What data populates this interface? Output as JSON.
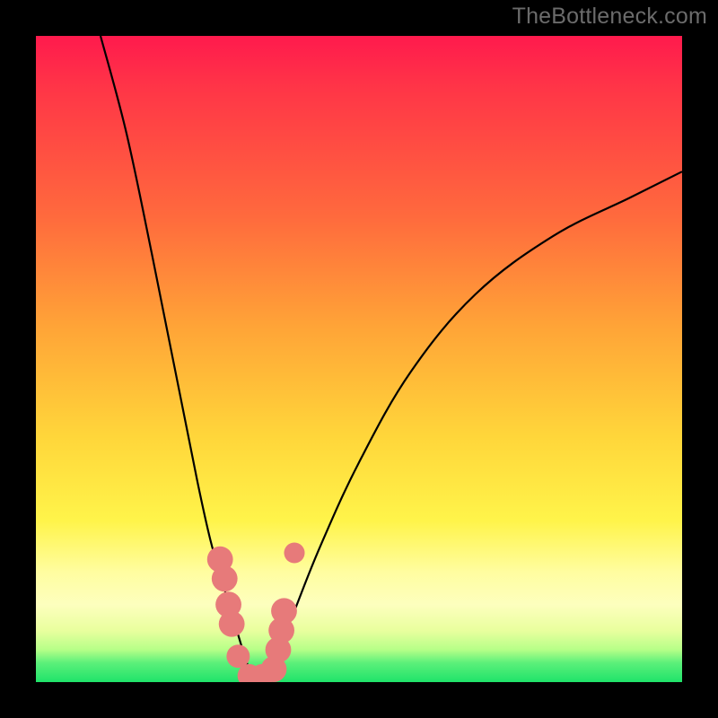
{
  "watermark": "TheBottleneck.com",
  "colors": {
    "bg_black": "#000000",
    "grad_top": "#ff1a4d",
    "grad_bottom": "#1fe36a",
    "curve": "#000000",
    "beads": "#e77a7a"
  },
  "chart_data": {
    "type": "line",
    "title": "",
    "xlabel": "",
    "ylabel": "",
    "xlim": [
      0,
      100
    ],
    "ylim": [
      0,
      100
    ],
    "grid": false,
    "description": "Bottleneck-style plot: y represents mismatch/bottleneck percentage on a red-to-green gradient background. Two black curves descend steeply from the top, meeting in a narrow valley near x≈34 at y≈0 (green zone), then the right branch rises toward the top-right. Salmon beads mark sampled points in the valley region.",
    "series": [
      {
        "name": "left-branch",
        "x": [
          10,
          14,
          18,
          22,
          25,
          27,
          29,
          30.5,
          32,
          33,
          34
        ],
        "y": [
          100,
          85,
          66,
          46,
          31,
          22,
          15,
          10,
          5,
          2,
          0
        ]
      },
      {
        "name": "right-branch",
        "x": [
          34,
          36,
          38,
          40,
          44,
          50,
          58,
          68,
          80,
          92,
          100
        ],
        "y": [
          0,
          2,
          6,
          11,
          21,
          34,
          48,
          60,
          69,
          75,
          79
        ]
      }
    ],
    "markers": [
      {
        "x": 28.5,
        "y": 19,
        "r": 2.0
      },
      {
        "x": 29.2,
        "y": 16,
        "r": 2.0
      },
      {
        "x": 29.8,
        "y": 12,
        "r": 2.0
      },
      {
        "x": 30.3,
        "y": 9,
        "r": 2.0
      },
      {
        "x": 31.3,
        "y": 4,
        "r": 1.8
      },
      {
        "x": 33.0,
        "y": 1,
        "r": 1.8
      },
      {
        "x": 35.0,
        "y": 1,
        "r": 1.8
      },
      {
        "x": 36.8,
        "y": 2,
        "r": 2.0
      },
      {
        "x": 37.5,
        "y": 5,
        "r": 2.0
      },
      {
        "x": 38.0,
        "y": 8,
        "r": 2.0
      },
      {
        "x": 38.4,
        "y": 11,
        "r": 2.0
      },
      {
        "x": 40.0,
        "y": 20,
        "r": 1.6
      }
    ]
  }
}
